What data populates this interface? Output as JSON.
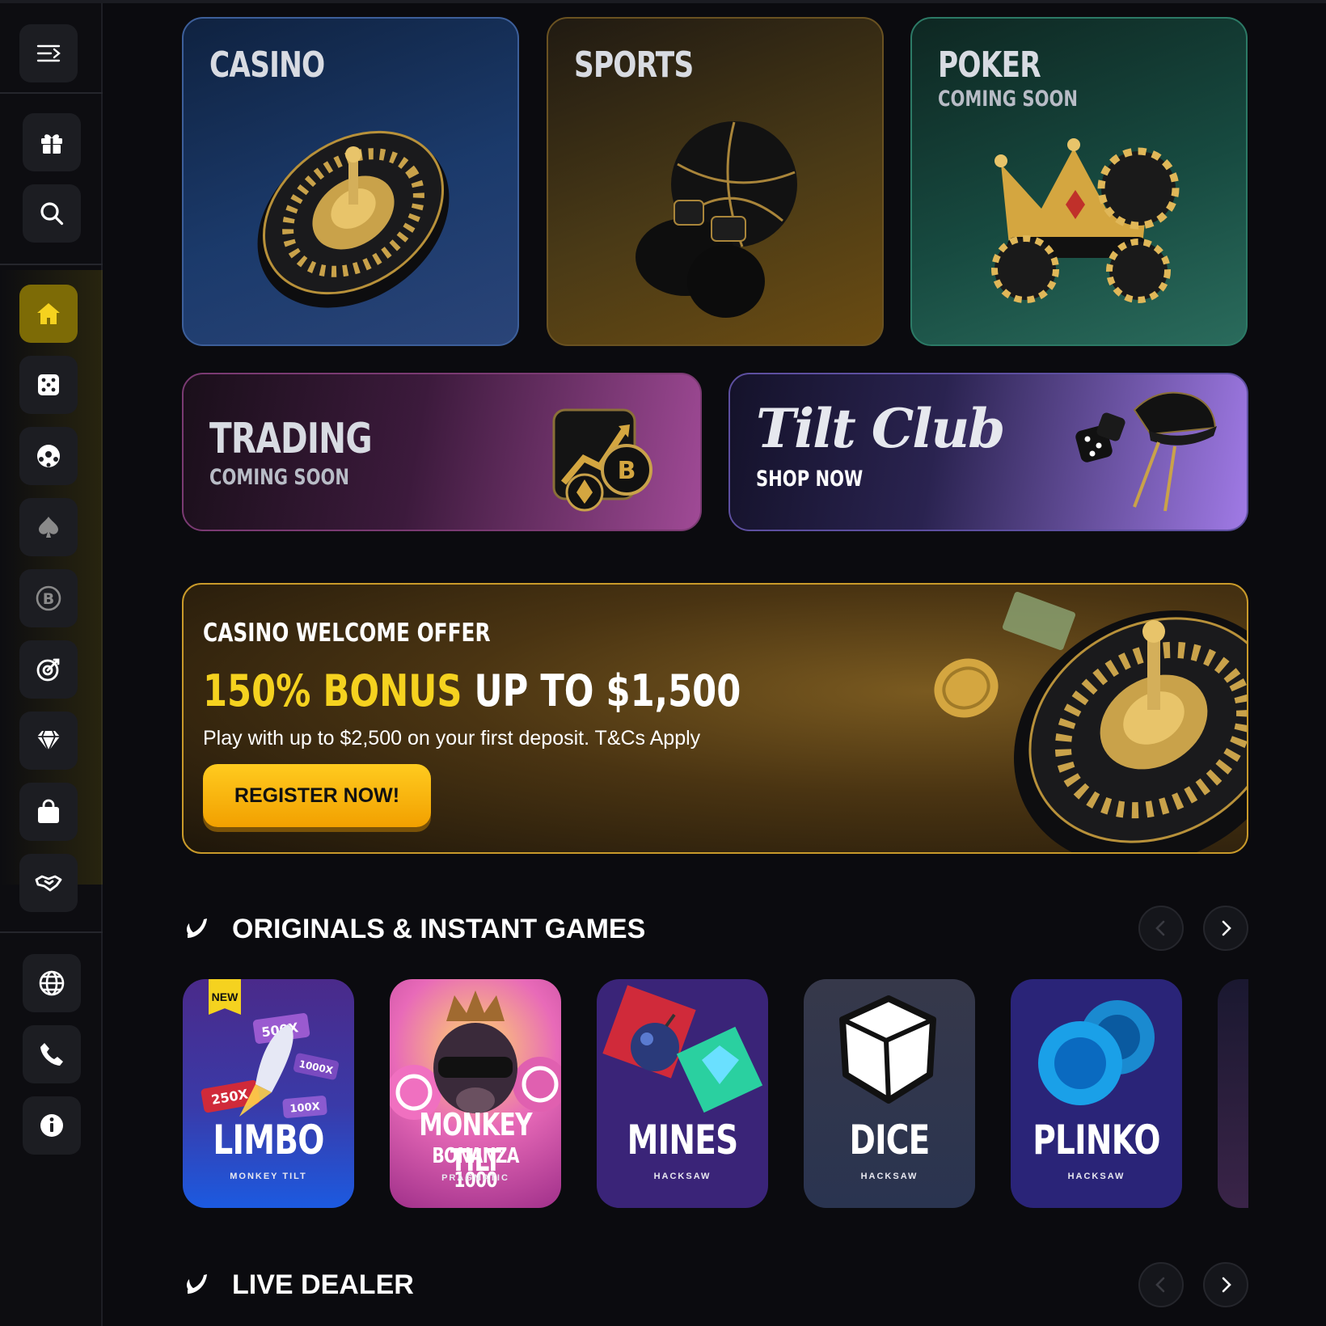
{
  "sidebar": {
    "items": [
      {
        "icon": "menu-collapse-icon",
        "active": false
      },
      {
        "icon": "gift-icon",
        "active": false
      },
      {
        "icon": "search-icon",
        "active": false
      },
      {
        "icon": "home-icon",
        "active": true
      },
      {
        "icon": "dice-icon",
        "active": false
      },
      {
        "icon": "soccer-ball-icon",
        "active": false
      },
      {
        "icon": "spade-icon",
        "active": false
      },
      {
        "icon": "bitcoin-icon",
        "active": false
      },
      {
        "icon": "target-icon",
        "active": false
      },
      {
        "icon": "diamond-icon",
        "active": false
      },
      {
        "icon": "shopping-bag-icon",
        "active": false
      },
      {
        "icon": "handshake-icon",
        "active": false
      },
      {
        "icon": "globe-icon",
        "active": false
      },
      {
        "icon": "phone-icon",
        "active": false
      },
      {
        "icon": "info-icon",
        "active": false
      }
    ]
  },
  "tiles": {
    "casino": {
      "title": "CASINO"
    },
    "sports": {
      "title": "SPORTS"
    },
    "poker": {
      "title": "POKER",
      "subtitle": "COMING SOON"
    },
    "trading": {
      "title": "TRADING",
      "subtitle": "COMING SOON"
    },
    "tilt_club": {
      "title": "Tilt Club",
      "subtitle": "SHOP NOW"
    }
  },
  "promo": {
    "kicker": "CASINO WELCOME OFFER",
    "headline_highlight": "150% BONUS",
    "headline_rest": " UP TO $1,500",
    "description": "Play with up to $2,500 on your first deposit. T&Cs Apply",
    "button": "REGISTER NOW!"
  },
  "sections": {
    "originals": {
      "title": "ORIGINALS & INSTANT GAMES"
    },
    "live_dealer": {
      "title": "LIVE DEALER"
    }
  },
  "games": [
    {
      "name": "LIMBO",
      "provider": "MONKEY TILT",
      "badge": "NEW"
    },
    {
      "name": "MONKEY TILT",
      "name2": "BONANZA 1000",
      "provider": "PRAGMATIC"
    },
    {
      "name": "MINES",
      "provider": "HACKSAW"
    },
    {
      "name": "DICE",
      "provider": "HACKSAW"
    },
    {
      "name": "PLINKO",
      "provider": "HACKSAW"
    }
  ],
  "colors": {
    "accent_yellow": "#f5d21f",
    "active_nav": "#7d6b06",
    "background": "#0b0b0f"
  }
}
